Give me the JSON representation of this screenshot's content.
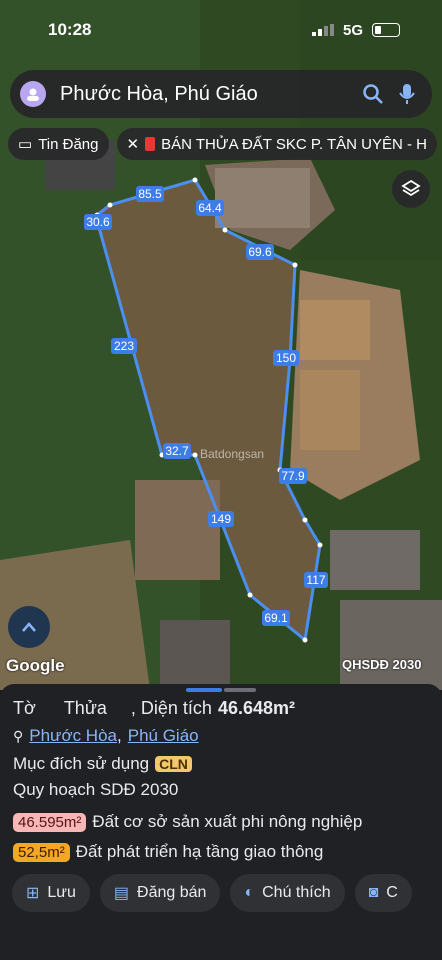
{
  "status": {
    "time": "10:28",
    "network": "5G"
  },
  "search": {
    "text": "Phước Hòa, Phú Giáo"
  },
  "chips": {
    "listing_label": "Tin Đăng",
    "ad_label": "BÁN THỬA ĐẤT SKC P. TÂN UYÊN - H"
  },
  "map": {
    "parcel_labels": [
      "85.5",
      "64.4",
      "30.6",
      "69.6",
      "223",
      "150",
      "32.7",
      "77.9",
      "149",
      "117",
      "69.1"
    ],
    "watermark": "Batdongsan",
    "attribution": "Google",
    "overlay_tag": "QHSDĐ 2030"
  },
  "sheet": {
    "title_prefix": "Tờ",
    "title_parcel": "Thửa",
    "title_area_label": ", Diện tích",
    "title_area_value": "46.648m²",
    "location_ward": "Phước Hòa",
    "location_sep": ",",
    "location_district": "Phú Giáo",
    "purpose_label": "Mục đích sử dụng",
    "purpose_code": "CLN",
    "plan_label": "Quy hoạch SDĐ 2030",
    "zones": [
      {
        "area": "46.595m²",
        "label": "Đất cơ sở sản xuất phi nông nghiệp",
        "color": "#f7b7b7"
      },
      {
        "area": "52,5m²",
        "label": "Đất phát triển hạ tầng giao thông",
        "color": "#f5a623"
      }
    ],
    "actions": [
      "Lưu",
      "Đăng bán",
      "Chú thích",
      "C"
    ]
  }
}
